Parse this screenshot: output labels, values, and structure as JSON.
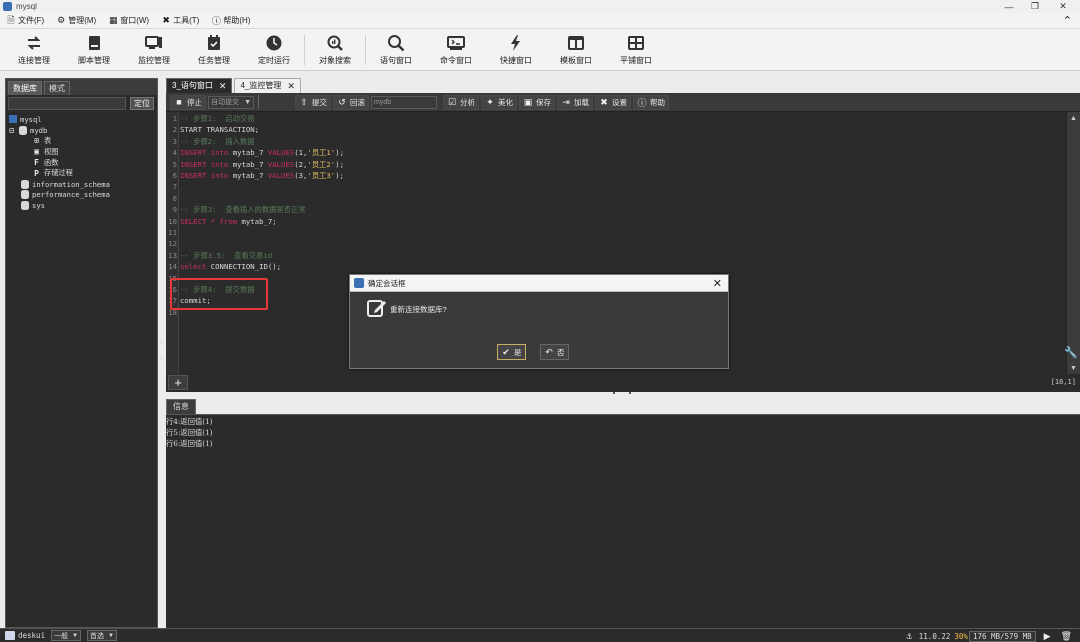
{
  "window": {
    "title": "mysql"
  },
  "menu": [
    {
      "label": "文件(F)",
      "icon": "file-icon"
    },
    {
      "label": "管理(M)",
      "icon": "gear-icon"
    },
    {
      "label": "窗口(W)",
      "icon": "window-icon"
    },
    {
      "label": "工具(T)",
      "icon": "tools-icon"
    },
    {
      "label": "帮助(H)",
      "icon": "help-icon"
    }
  ],
  "toolbar": [
    {
      "label": "连接管理",
      "icon": "connection-icon"
    },
    {
      "label": "脚本管理",
      "icon": "script-icon"
    },
    {
      "label": "监控管理",
      "icon": "monitor-icon"
    },
    {
      "label": "任务管理",
      "icon": "task-icon"
    },
    {
      "label": "定时运行",
      "icon": "clock-icon"
    },
    {
      "label": "对象搜索",
      "icon": "object-search-icon"
    },
    {
      "label": "语句窗口",
      "icon": "search-icon"
    },
    {
      "label": "命令窗口",
      "icon": "terminal-icon"
    },
    {
      "label": "快捷窗口",
      "icon": "lightning-icon"
    },
    {
      "label": "模板窗口",
      "icon": "template-icon"
    },
    {
      "label": "平铺窗口",
      "icon": "tile-icon"
    }
  ],
  "left_panel": {
    "tabs": [
      "数据库",
      "模式"
    ],
    "locate_button": "定位",
    "tree": [
      {
        "label": "mysql",
        "level": 0,
        "icon": "server-icon"
      },
      {
        "label": "mydb",
        "level": 1,
        "icon": "database-icon"
      },
      {
        "label": "表",
        "level": 2,
        "icon": "table-icon"
      },
      {
        "label": "视图",
        "level": 2,
        "icon": "view-icon"
      },
      {
        "label": "函数",
        "level": 2,
        "icon": "function-icon"
      },
      {
        "label": "存储过程",
        "level": 2,
        "icon": "procedure-icon"
      },
      {
        "label": "information_schema",
        "level": 1,
        "icon": "database-icon"
      },
      {
        "label": "performance_schema",
        "level": 1,
        "icon": "database-icon"
      },
      {
        "label": "sys",
        "level": 1,
        "icon": "database-icon"
      }
    ]
  },
  "editor": {
    "tabs": [
      {
        "label": "3_语句窗口",
        "active": true
      },
      {
        "label": "4_监控管理",
        "active": false
      }
    ],
    "toolbar": {
      "stop": "停止",
      "db_select": "自动提交",
      "commit": "提交",
      "rollback": "回滚",
      "schema_select": "mydb",
      "analyze": "分析",
      "beautify": "美化",
      "save": "保存",
      "load": "加载",
      "settings": "设置",
      "help": "帮助"
    },
    "lines": [
      {
        "n": "1",
        "tokens": [
          {
            "t": "-- 步骤1:  启动交易",
            "c": "cmt"
          }
        ]
      },
      {
        "n": "2",
        "tokens": [
          {
            "t": "START TRANSACTION;",
            "c": "id"
          }
        ]
      },
      {
        "n": "3",
        "tokens": [
          {
            "t": "-- 步骤2:  插入数据",
            "c": "cmt"
          }
        ]
      },
      {
        "n": "4",
        "tokens": [
          {
            "t": "INSERT into ",
            "c": "kw"
          },
          {
            "t": "mytab_7 ",
            "c": "id"
          },
          {
            "t": "VALUES",
            "c": "kw"
          },
          {
            "t": "(1,",
            "c": "id"
          },
          {
            "t": "'员工1'",
            "c": "str"
          },
          {
            "t": ");",
            "c": "id"
          }
        ]
      },
      {
        "n": "5",
        "tokens": [
          {
            "t": "INSERT into ",
            "c": "kw"
          },
          {
            "t": "mytab_7 ",
            "c": "id"
          },
          {
            "t": "VALUES",
            "c": "kw"
          },
          {
            "t": "(2,",
            "c": "id"
          },
          {
            "t": "'员工2'",
            "c": "str"
          },
          {
            "t": ");",
            "c": "id"
          }
        ]
      },
      {
        "n": "6",
        "tokens": [
          {
            "t": "INSERT into ",
            "c": "kw"
          },
          {
            "t": "mytab_7 ",
            "c": "id"
          },
          {
            "t": "VALUES",
            "c": "kw"
          },
          {
            "t": "(3,",
            "c": "id"
          },
          {
            "t": "'员工3'",
            "c": "str"
          },
          {
            "t": ");",
            "c": "id"
          }
        ]
      },
      {
        "n": "7",
        "tokens": []
      },
      {
        "n": "8",
        "tokens": []
      },
      {
        "n": "9",
        "tokens": [
          {
            "t": "-- 步骤3:  查看插入的数据是否正常",
            "c": "cmt"
          }
        ]
      },
      {
        "n": "10",
        "tokens": [
          {
            "t": "SELECT * from ",
            "c": "kw"
          },
          {
            "t": "mytab_7;",
            "c": "id"
          }
        ]
      },
      {
        "n": "11",
        "tokens": []
      },
      {
        "n": "12",
        "tokens": []
      },
      {
        "n": "13",
        "tokens": [
          {
            "t": "-- 步骤3.5:  查看交易id",
            "c": "cmt"
          }
        ]
      },
      {
        "n": "14",
        "tokens": [
          {
            "t": "select ",
            "c": "kw"
          },
          {
            "t": "CONNECTION_ID();",
            "c": "id"
          }
        ]
      },
      {
        "n": "15",
        "tokens": []
      },
      {
        "n": "16",
        "tokens": [
          {
            "t": "-- 步骤4:  提交数据",
            "c": "cmt"
          }
        ]
      },
      {
        "n": "17",
        "tokens": [
          {
            "t": "commit;",
            "c": "id"
          }
        ]
      },
      {
        "n": "18",
        "tokens": []
      }
    ],
    "cursor_position": "[16,1]"
  },
  "info": {
    "tab": "信息",
    "lines": [
      "行4:返回值(1)",
      "行5:返回值(1)",
      "行6:返回值(1)"
    ]
  },
  "dialog": {
    "title": "确定会话框",
    "message": "重新连接数据库?",
    "yes": "是",
    "no": "否"
  },
  "status": {
    "user": "deskui",
    "select1": "一般",
    "select2": "首选",
    "version": "11.0.22",
    "percent": "30%",
    "memory": "176 MB/579 MB"
  },
  "colors": {
    "keyword": "#cc2e5e",
    "comment": "#5a7a5a",
    "string": "#e0c060",
    "highlight_box": "#e53935"
  }
}
